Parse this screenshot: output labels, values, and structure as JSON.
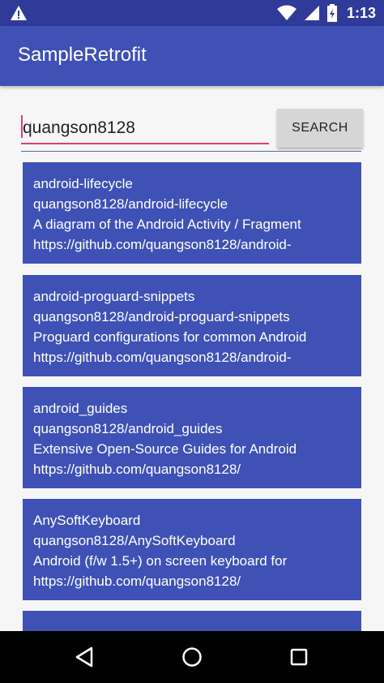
{
  "status_bar": {
    "time": "1:13",
    "icons": [
      "warning-icon",
      "wifi-icon",
      "signal-icon",
      "battery-icon"
    ]
  },
  "app_bar": {
    "title": "SampleRetrofit"
  },
  "search": {
    "value": "quangson8128",
    "button_label": "SEARCH"
  },
  "repos": [
    {
      "name": "android-lifecycle",
      "full_name": "quangson8128/android-lifecycle",
      "description": "A diagram of the Android Activity / Fragment",
      "url": "https://github.com/quangson8128/android-"
    },
    {
      "name": "android-proguard-snippets",
      "full_name": "quangson8128/android-proguard-snippets",
      "description": "Proguard configurations for common Android",
      "url": "https://github.com/quangson8128/android-"
    },
    {
      "name": "android_guides",
      "full_name": "quangson8128/android_guides",
      "description": "Extensive Open-Source Guides for Android",
      "url": "https://github.com/quangson8128/"
    },
    {
      "name": "AnySoftKeyboard",
      "full_name": "quangson8128/AnySoftKeyboard",
      "description": "Android (f/w 1.5+) on screen keyboard for",
      "url": "https://github.com/quangson8128/"
    }
  ],
  "colors": {
    "primary": "#3f51b5",
    "primary_dark": "#2f3a99",
    "accent": "#e0406e"
  }
}
